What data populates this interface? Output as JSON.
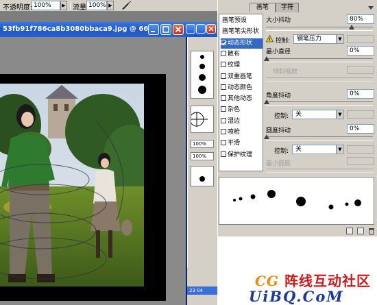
{
  "options_bar": {
    "opacity_label": "不透明度:",
    "opacity_value": "100%",
    "flow_label": "流量:",
    "flow_value": "100%"
  },
  "document": {
    "title": "53fb91f786ca8b3080bbaca9.jpg @ 66..."
  },
  "second_window": {
    "zoom_a": "100%",
    "zoom_b": "100%",
    "status": "23 04"
  },
  "palette": {
    "tabs": [
      "画笔",
      "字符"
    ],
    "left_items": [
      {
        "label": "画笔预设",
        "checkbox": false,
        "checked": false,
        "selected": false
      },
      {
        "label": "画笔笔尖形状",
        "checkbox": false,
        "checked": false,
        "selected": false
      },
      {
        "label": "动态形状",
        "checkbox": true,
        "checked": true,
        "selected": true
      },
      {
        "label": "散布",
        "checkbox": true,
        "checked": false,
        "selected": false
      },
      {
        "label": "纹理",
        "checkbox": true,
        "checked": false,
        "selected": false
      },
      {
        "label": "双重画笔",
        "checkbox": true,
        "checked": false,
        "selected": false
      },
      {
        "label": "动态颜色",
        "checkbox": true,
        "checked": false,
        "selected": false
      },
      {
        "label": "其他动态",
        "checkbox": true,
        "checked": false,
        "selected": false
      },
      {
        "label": "杂色",
        "checkbox": true,
        "checked": false,
        "selected": false
      },
      {
        "label": "湿边",
        "checkbox": true,
        "checked": false,
        "selected": false
      },
      {
        "label": "喷枪",
        "checkbox": true,
        "checked": false,
        "selected": false
      },
      {
        "label": "平滑",
        "checkbox": true,
        "checked": false,
        "selected": false
      },
      {
        "label": "保护纹理",
        "checkbox": true,
        "checked": false,
        "selected": false
      }
    ],
    "size_jitter_label": "大小抖动",
    "size_jitter_value": "80%",
    "size_jitter_level": 0.8,
    "control_label": "控制:",
    "control_size_value": "钢笔压力",
    "min_diameter_label": "最小直径",
    "min_diameter_value": "0%",
    "tilt_scale_label": "倾斜缩放",
    "angle_jitter_label": "角度抖动",
    "angle_jitter_value": "0%",
    "control_angle_value": "关",
    "roundness_jitter_label": "圆度抖动",
    "roundness_jitter_value": "0%",
    "control_round_value": "关",
    "min_roundness_label": "最小圆度"
  },
  "watermark": {
    "cg": "CG",
    "chinese": "阵线互动社区",
    "url": "UiBQ.CoM"
  },
  "colors": {
    "title_bar": "#1f57c7",
    "selection": "#316ac5",
    "panel_bg": "#d4d0c8"
  }
}
